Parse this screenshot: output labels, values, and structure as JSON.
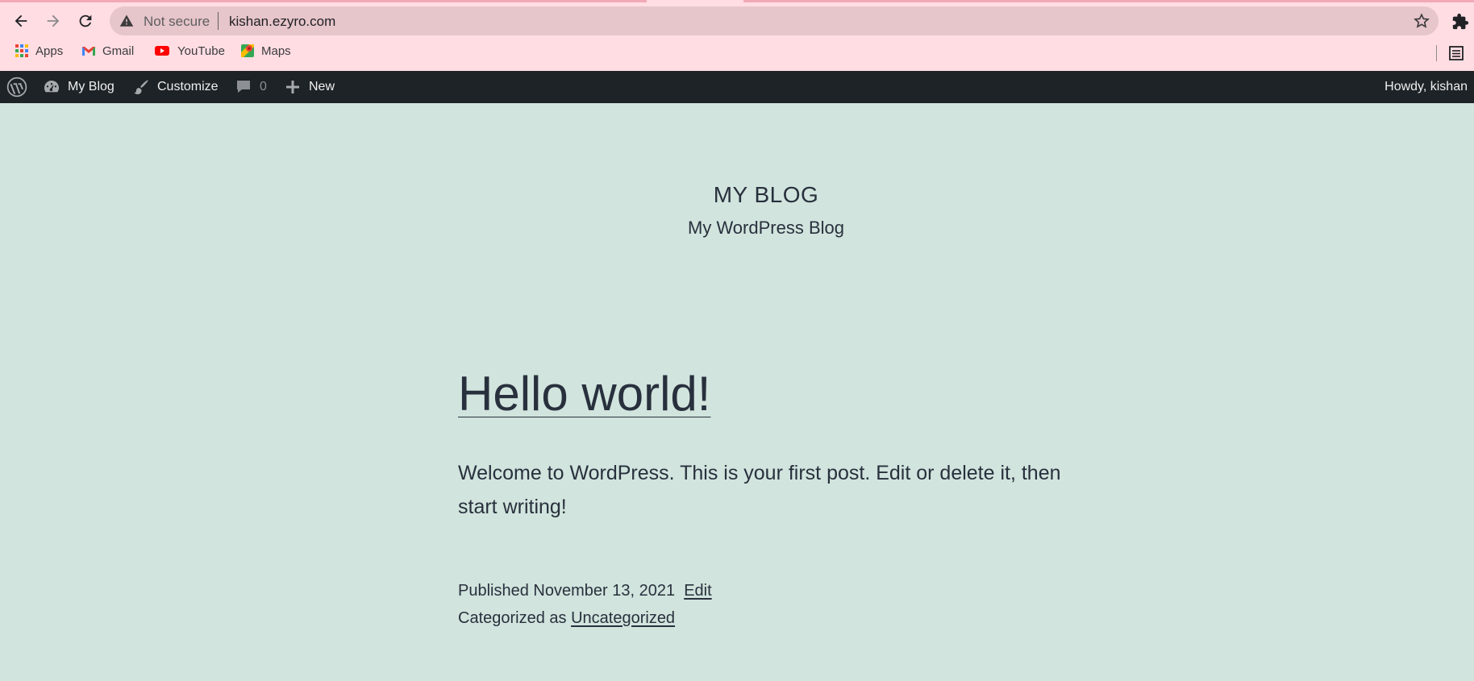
{
  "browser": {
    "omnibox": {
      "security_label": "Not secure",
      "url": "kishan.ezyro.com"
    },
    "bookmarks": [
      {
        "label": "Apps",
        "icon": "apps-grid-icon"
      },
      {
        "label": "Gmail",
        "icon": "gmail-icon"
      },
      {
        "label": "YouTube",
        "icon": "youtube-icon"
      },
      {
        "label": "Maps",
        "icon": "maps-icon"
      }
    ]
  },
  "adminbar": {
    "site_name": "My Blog",
    "customize": "Customize",
    "comments_count": "0",
    "new": "New",
    "howdy": "Howdy, kishan"
  },
  "site": {
    "title": "MY BLOG",
    "description": "My WordPress Blog"
  },
  "post": {
    "title": "Hello world!",
    "body": "Welcome to WordPress. This is your first post. Edit or delete it, then start writing!",
    "published_prefix": "Published",
    "published_date": "November 13, 2021",
    "edit_link": "Edit",
    "categorized_prefix": "Categorized as",
    "category": "Uncategorized"
  },
  "colors": {
    "chrome_bg": "#ffdde3",
    "adminbar_bg": "#1d2327",
    "page_bg": "#d1e4dd",
    "text": "#28303d"
  }
}
